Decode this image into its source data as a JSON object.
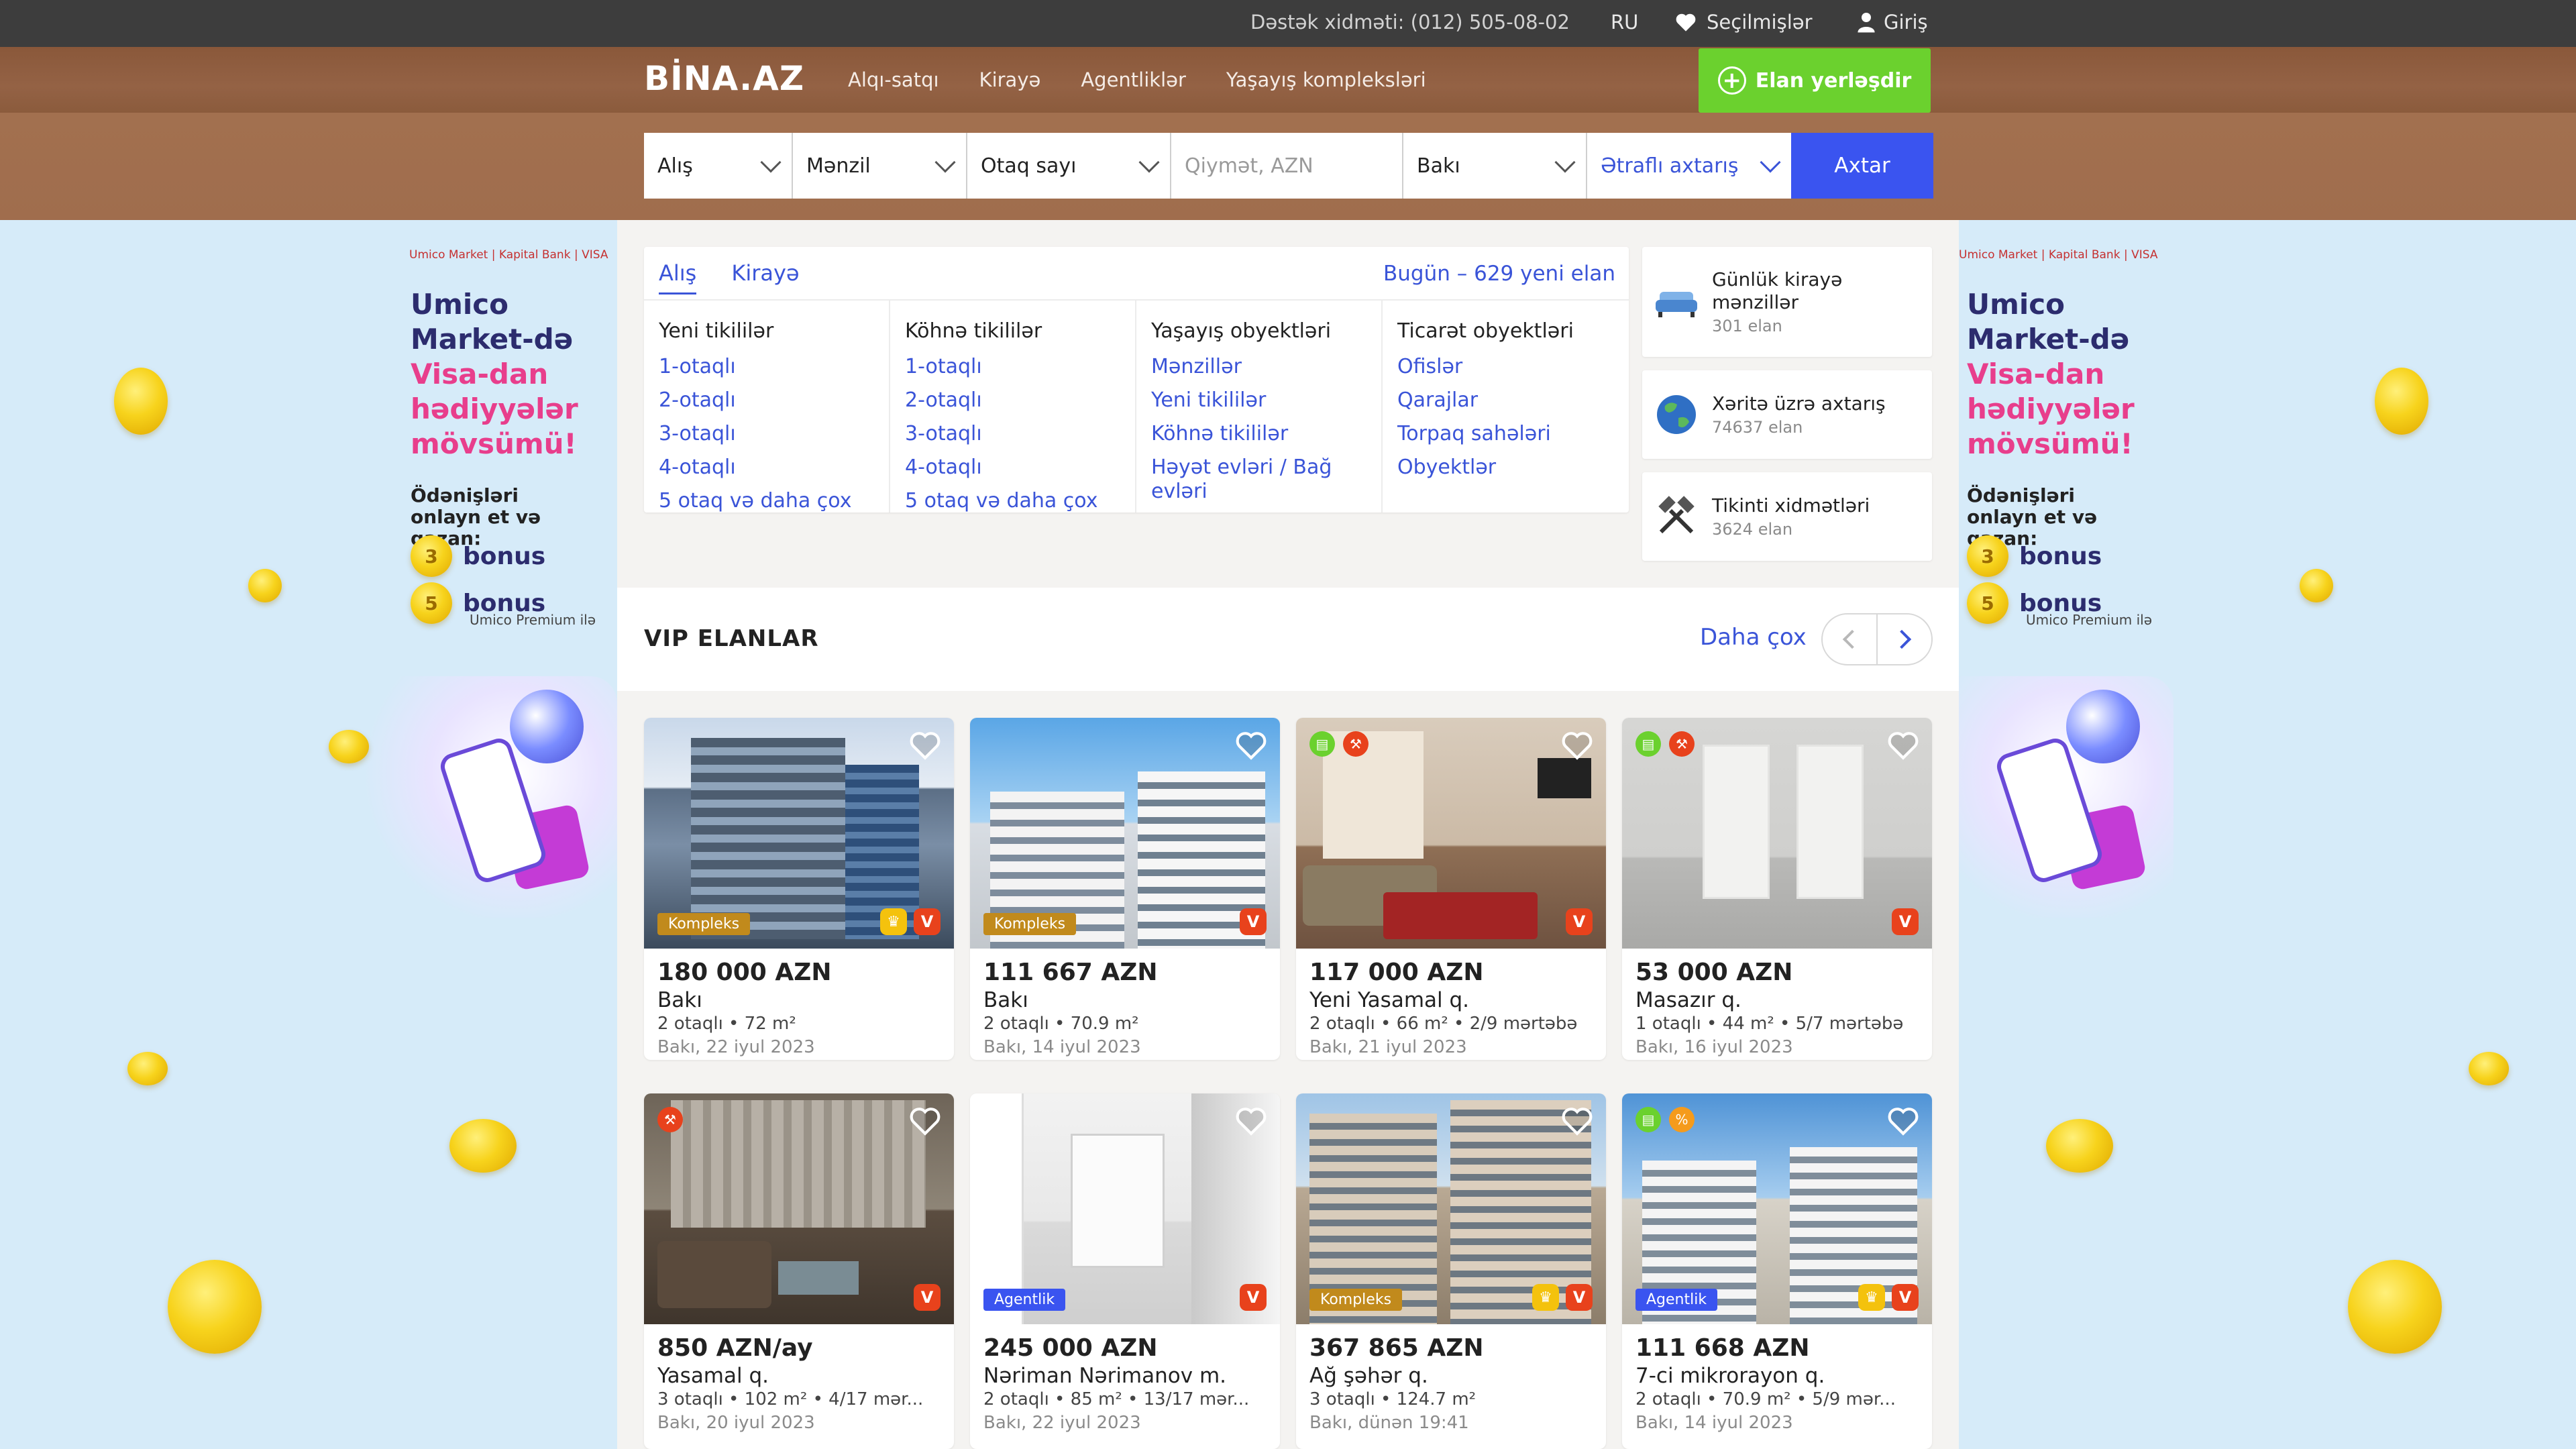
{
  "topbar": {
    "support": "Dəstək xidməti: (012) 505-08-02",
    "lang": "RU",
    "favorites": "Seçilmişlər",
    "login": "Giriş"
  },
  "header": {
    "logo": "BİNA.AZ",
    "nav": [
      "Alqı-satqı",
      "Kirayə",
      "Agentliklər",
      "Yaşayış kompleksləri"
    ],
    "post_button": "Elan yerləşdir"
  },
  "search": {
    "deal": "Alış",
    "type": "Mənzil",
    "rooms": "Otaq sayı",
    "price_placeholder": "Qiymət, AZN",
    "city": "Bakı",
    "advanced": "Ətraflı axtarış",
    "submit": "Axtar"
  },
  "banner": {
    "brand_row": "Umico Market | Kapital Bank | VISA",
    "title_line1": "Umico",
    "title_line2": "Market-də",
    "title_pink1": "Visa-dan",
    "title_pink2": "hədiyyələr",
    "title_pink3": "mövsümü!",
    "subtitle": "Ödənişləri onlayn et və qazan:",
    "bonus1_num": "3",
    "bonus1": "bonus",
    "bonus2_num": "5",
    "bonus2": "bonus",
    "premium_note": "Umico Premium ilə"
  },
  "categories": {
    "tabs": [
      "Alış",
      "Kirayə"
    ],
    "today": "Bugün – 629 yeni elan",
    "columns": [
      {
        "heading": "Yeni tikililər",
        "links": [
          "1-otaqlı",
          "2-otaqlı",
          "3-otaqlı",
          "4-otaqlı",
          "5 otaq və daha çox"
        ]
      },
      {
        "heading": "Köhnə tikililər",
        "links": [
          "1-otaqlı",
          "2-otaqlı",
          "3-otaqlı",
          "4-otaqlı",
          "5 otaq və daha çox"
        ]
      },
      {
        "heading": "Yaşayış obyektləri",
        "links": [
          "Mənzillər",
          "Yeni tikililər",
          "Köhnə tikililər",
          "Həyət evləri / Bağ evləri"
        ]
      },
      {
        "heading": "Ticarət obyektləri",
        "links": [
          "Ofislər",
          "Qarajlar",
          "Torpaq sahələri",
          "Obyektlər"
        ]
      }
    ]
  },
  "quick": [
    {
      "title": "Günlük kirayə mənzillər",
      "count": "301 elan",
      "icon": "sofa-icon"
    },
    {
      "title": "Xəritə üzrə axtarış",
      "count": "74637 elan",
      "icon": "globe-icon"
    },
    {
      "title": "Tikinti xidmətləri",
      "count": "3624 elan",
      "icon": "tools-icon"
    }
  ],
  "vip": {
    "title": "VIP ELANLAR",
    "more": "Daha çox"
  },
  "listings": [
    {
      "price": "180 000 AZN",
      "location": "Bakı",
      "details": "2 otaqlı • 72 m²",
      "date": "Bakı, 22 iyul 2023",
      "tag": "Kompleks"
    },
    {
      "price": "111 667 AZN",
      "location": "Bakı",
      "details": "2 otaqlı • 70.9 m²",
      "date": "Bakı, 14 iyul 2023",
      "tag": "Kompleks"
    },
    {
      "price": "117 000 AZN",
      "location": "Yeni Yasamal q.",
      "details": "2 otaqlı • 66 m² • 2/9 mərtəbə",
      "date": "Bakı, 21 iyul 2023",
      "tag": ""
    },
    {
      "price": "53 000 AZN",
      "location": "Masazır q.",
      "details": "1 otaqlı • 44 m² • 5/7 mərtəbə",
      "date": "Bakı, 16 iyul 2023",
      "tag": ""
    },
    {
      "price": "850 AZN/ay",
      "location": "Yasamal q.",
      "details": "3 otaqlı • 102 m² • 4/17 mər...",
      "date": "Bakı, 20 iyul 2023",
      "tag": ""
    },
    {
      "price": "245 000 AZN",
      "location": "Nəriman Nərimanov m.",
      "details": "2 otaqlı • 85 m² • 13/17 mər...",
      "date": "Bakı, 22 iyul 2023",
      "tag": "Agentlik"
    },
    {
      "price": "367 865 AZN",
      "location": "Ağ şəhər q.",
      "details": "3 otaqlı • 124.7 m²",
      "date": "Bakı, dünən 19:41",
      "tag": "Kompleks"
    },
    {
      "price": "111 668 AZN",
      "location": "7-ci mikrorayon q.",
      "details": "2 otaqlı • 70.9 m² • 5/9 mər...",
      "date": "Bakı, 14 iyul 2023",
      "tag": "Agentlik"
    }
  ],
  "colors": {
    "accent": "#3a54d8",
    "post_green": "#6bd12e",
    "header_brown": "#8a583a",
    "vip_red": "#e8421c"
  }
}
